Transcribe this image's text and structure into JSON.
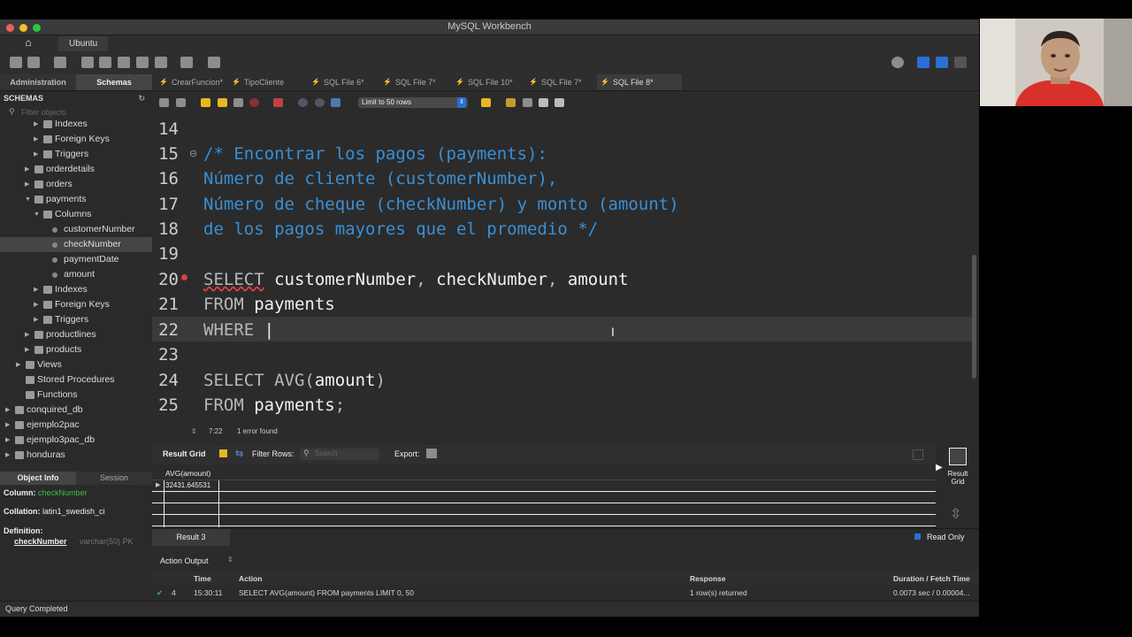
{
  "window": {
    "title": "MySQL Workbench"
  },
  "nav": {
    "tab": "Ubuntu"
  },
  "sidebar": {
    "tabs": [
      "Administration",
      "Schemas"
    ],
    "header": "SCHEMAS",
    "filter_placeholder": "Filter objects",
    "tree": [
      {
        "label": "Indexes",
        "level": 3,
        "arrow": "▶",
        "icon": "folder-icon"
      },
      {
        "label": "Foreign Keys",
        "level": 3,
        "arrow": "▶",
        "icon": "folder-icon"
      },
      {
        "label": "Triggers",
        "level": 3,
        "arrow": "▶",
        "icon": "folder-icon"
      },
      {
        "label": "orderdetails",
        "level": 2,
        "arrow": "▶",
        "icon": "table-icon"
      },
      {
        "label": "orders",
        "level": 2,
        "arrow": "▶",
        "icon": "table-icon"
      },
      {
        "label": "payments",
        "level": 2,
        "arrow": "▼",
        "icon": "table-icon"
      },
      {
        "label": "Columns",
        "level": 3,
        "arrow": "▼",
        "icon": "folder-icon"
      },
      {
        "label": "customerNumber",
        "level": 4,
        "arrow": "",
        "icon": "column-icon"
      },
      {
        "label": "checkNumber",
        "level": 4,
        "arrow": "",
        "icon": "column-icon",
        "selected": true
      },
      {
        "label": "paymentDate",
        "level": 4,
        "arrow": "",
        "icon": "column-icon"
      },
      {
        "label": "amount",
        "level": 4,
        "arrow": "",
        "icon": "column-icon"
      },
      {
        "label": "Indexes",
        "level": 3,
        "arrow": "▶",
        "icon": "folder-icon"
      },
      {
        "label": "Foreign Keys",
        "level": 3,
        "arrow": "▶",
        "icon": "folder-icon"
      },
      {
        "label": "Triggers",
        "level": 3,
        "arrow": "▶",
        "icon": "folder-icon"
      },
      {
        "label": "productlines",
        "level": 2,
        "arrow": "▶",
        "icon": "table-icon"
      },
      {
        "label": "products",
        "level": 2,
        "arrow": "▶",
        "icon": "table-icon"
      },
      {
        "label": "Views",
        "level": 1,
        "arrow": "▶",
        "icon": "folder-icon"
      },
      {
        "label": "Stored Procedures",
        "level": 1,
        "arrow": "",
        "icon": "folder-icon"
      },
      {
        "label": "Functions",
        "level": 1,
        "arrow": "",
        "icon": "folder-icon"
      },
      {
        "label": "conquired_db",
        "level": 0,
        "arrow": "▶",
        "icon": "db-icon"
      },
      {
        "label": "ejemplo2pac",
        "level": 0,
        "arrow": "▶",
        "icon": "db-icon"
      },
      {
        "label": "ejemplo3pac_db",
        "level": 0,
        "arrow": "▶",
        "icon": "db-icon"
      },
      {
        "label": "honduras",
        "level": 0,
        "arrow": "▶",
        "icon": "db-icon"
      }
    ]
  },
  "object_info": {
    "tabs": [
      "Object Info",
      "Session"
    ],
    "column_label": "Column:",
    "column_value": "checkNumber",
    "collation_label": "Collation:",
    "collation_value": "latin1_swedish_ci",
    "definition_label": "Definition:",
    "def_name": "checkNumber",
    "def_type": "varchar(50) PK"
  },
  "editor_tabs": [
    "CrearFuncion*",
    "TipoCliente",
    "SQL File 6*",
    "SQL File 7*",
    "SQL File 10*",
    "SQL File 7*",
    "SQL File 8*"
  ],
  "editor_toolbar": {
    "limit": "Limit to 50 rows"
  },
  "editor": {
    "line_numbers": [
      "14",
      "15",
      "16",
      "17",
      "18",
      "19",
      "20",
      "21",
      "22",
      "23",
      "24",
      "25"
    ],
    "comment": [
      "/* Encontrar los pagos (payments):",
      "Número de cliente (customerNumber),",
      "Número de cheque (checkNumber) y monto (amount)",
      "de los pagos mayores que el promedio */"
    ],
    "l20_kw": "SELECT",
    "l20_a": "customerNumber",
    "l20_b": "checkNumber",
    "l20_c": "amount",
    "l21_kw": "FROM",
    "l21_id": "payments",
    "l22_kw": "WHERE",
    "l24_kw": "SELECT AVG(",
    "l24_id": "amount",
    "l24_end": ")",
    "l25_kw": "FROM",
    "l25_id": "payments",
    "l25_end": ";"
  },
  "status": {
    "position": "7:22",
    "errors": "1 error found"
  },
  "result": {
    "grid_label": "Result Grid",
    "filter_label": "Filter Rows:",
    "search_placeholder": "Search",
    "export_label": "Export:",
    "column": "AVG(amount)",
    "value": "32431.645531",
    "side_btn_1": "Result",
    "side_btn_2": "Grid",
    "tab": "Result 3",
    "read_only": "Read Only"
  },
  "action_output": {
    "label": "Action Output",
    "columns": [
      "Time",
      "Action",
      "Response",
      "Duration / Fetch Time"
    ],
    "row": {
      "num": "4",
      "time": "15:30:11",
      "action": "SELECT AVG(amount) FROM payments LIMIT 0, 50",
      "response": "1 row(s) returned",
      "duration": "0.0073 sec / 0.00004..."
    }
  },
  "bottom_status": "Query Completed",
  "colors": {
    "comment": "#3a8fd4",
    "error": "#d94040",
    "ok": "#3fbf3f",
    "accent_blue": "#2a6fd6"
  }
}
